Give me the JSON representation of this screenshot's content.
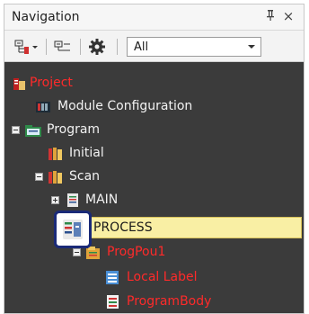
{
  "panel": {
    "title": "Navigation",
    "pin_glyph": "ᅟ",
    "close_glyph": "×"
  },
  "toolbar": {
    "buttons": [
      {
        "name": "tree-expand-icon"
      },
      {
        "name": "tree-collapse-icon"
      },
      {
        "name": "gear-icon"
      }
    ],
    "filter_value": "All"
  },
  "tree": {
    "items": [
      {
        "label": "Project",
        "color": "red"
      },
      {
        "label": "Module Configuration",
        "color": "white"
      },
      {
        "label": "Program",
        "color": "white",
        "expander": "minus"
      },
      {
        "label": "Initial",
        "color": "white"
      },
      {
        "label": "Scan",
        "color": "white",
        "expander": "minus"
      },
      {
        "label": "MAIN",
        "color": "white",
        "expander": "plus"
      },
      {
        "label": "PROCESS",
        "color": "dark",
        "expander": "minus",
        "selected": true
      },
      {
        "label": "ProgPou1",
        "color": "red",
        "expander": "minus"
      },
      {
        "label": "Local Label",
        "color": "red"
      },
      {
        "label": "ProgramBody",
        "color": "red"
      }
    ]
  },
  "colors": {
    "panel_bg": "#3b3b3b",
    "selected_bg": "#f9efa4",
    "red_text": "#ff2a2a",
    "highlight_border": "#1a2a78"
  }
}
